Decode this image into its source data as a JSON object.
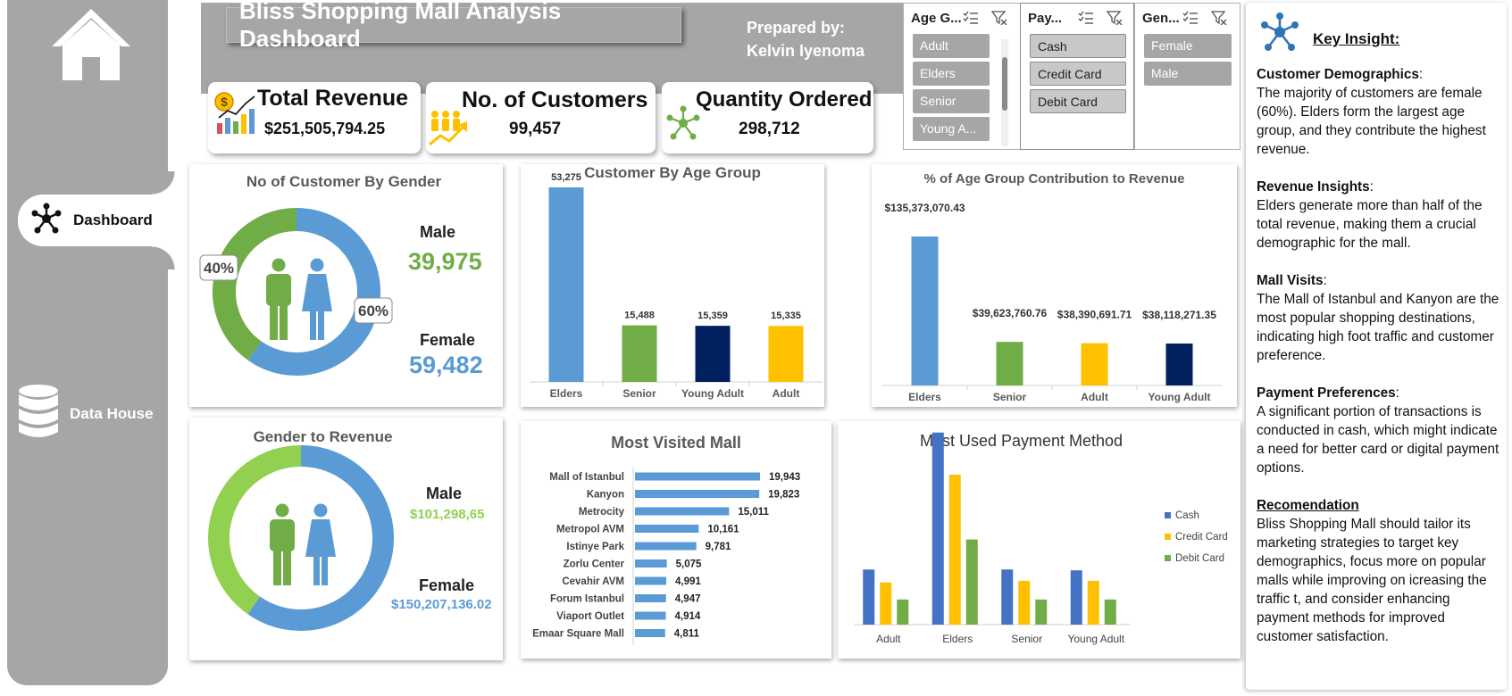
{
  "header": {
    "title": "Bliss Shopping Mall Analysis Dashboard",
    "prepared_label": "Prepared by:",
    "prepared_name": "Kelvin Iyenoma"
  },
  "sidebar": {
    "dashboard_label": "Dashboard",
    "datahouse_label": "Data House"
  },
  "kpis": {
    "revenue": {
      "title": "Total Revenue",
      "value": "$251,505,794.25"
    },
    "customers": {
      "title": "No. of Customers",
      "value": "99,457"
    },
    "quantity": {
      "title": "Quantity Ordered",
      "value": "298,712"
    }
  },
  "slicers": {
    "age": {
      "header": "Age G...",
      "items": [
        "Adult",
        "Elders",
        "Senior",
        "Young A..."
      ]
    },
    "payment": {
      "header": "Pay...",
      "items": [
        "Cash",
        "Credit Card",
        "Debit Card"
      ]
    },
    "gender": {
      "header": "Gen...",
      "items": [
        "Female",
        "Male"
      ]
    }
  },
  "colors": {
    "blue": "#5b9bd5",
    "green": "#70ad47",
    "light_green": "#92d050",
    "navy": "#002060",
    "gold": "#ffc000",
    "royal": "#4472c4"
  },
  "icons": [
    "home-icon",
    "network-icon",
    "database-icon",
    "revenue-chart-icon",
    "customers-growth-icon",
    "molecule-icon",
    "checklist-icon",
    "clear-filter-icon",
    "male-icon",
    "female-icon"
  ],
  "gender_customers": {
    "title": "No of Customer By Gender",
    "male_label": "Male",
    "male_value": "39,975",
    "female_label": "Female",
    "female_value": "59,482",
    "male_pct_label": "40%",
    "female_pct_label": "60%"
  },
  "gender_revenue": {
    "title": "Gender to Revenue",
    "male_label": "Male",
    "male_value": "$101,298,65",
    "female_label": "Female",
    "female_value": "$150,207,136.02"
  },
  "insights": {
    "title": "Key Insight:",
    "sections": [
      {
        "heading": "Customer Demographics",
        "text": "The majority of customers are female (60%). Elders form the largest age group, and they contribute the highest revenue."
      },
      {
        "heading": "Revenue Insights",
        "text": "Elders generate more than half of the total revenue, making them a crucial demographic for the mall."
      },
      {
        "heading": "Mall Visits",
        "text": "The Mall of Istanbul and Kanyon are the most popular shopping destinations, indicating high foot traffic and customer preference."
      },
      {
        "heading": "Payment Preferences",
        "text": "A significant portion of transactions is conducted in cash, which might indicate a need for better card or digital payment options."
      },
      {
        "heading": "Recomendation",
        "text": "Bliss Shopping Mall should tailor its marketing strategies to target key demographics, focus more on popular malls while improving on icreasing the traffic t, and consider enhancing payment methods for improved customer satisfaction."
      }
    ]
  },
  "chart_data": [
    {
      "type": "pie",
      "title": "No of Customer By Gender",
      "categories": [
        "Male",
        "Female"
      ],
      "values": [
        39975,
        59482
      ],
      "data_labels": [
        "40%",
        "60%"
      ]
    },
    {
      "type": "bar",
      "title": "Customer By Age Group",
      "categories": [
        "Elders",
        "Senior",
        "Young Adult",
        "Adult"
      ],
      "values": [
        53275,
        15488,
        15359,
        15335
      ],
      "data_labels": [
        "53,275",
        "15,488",
        "15,359",
        "15,335"
      ],
      "bar_colors": [
        "#5b9bd5",
        "#70ad47",
        "#002060",
        "#ffc000"
      ],
      "ylim": [
        0,
        53275
      ]
    },
    {
      "type": "bar",
      "title": "% of Age Group Contribution  to Revenue",
      "categories": [
        "Elders",
        "Senior",
        "Adult",
        "Young Adult"
      ],
      "values": [
        135373070.43,
        39623760.76,
        38390691.71,
        38118271.35
      ],
      "data_labels": [
        "$135,373,070.43",
        "$39,623,760.76",
        "$38,390,691.71",
        "$38,118,271.35"
      ],
      "bar_colors": [
        "#5b9bd5",
        "#70ad47",
        "#ffc000",
        "#002060"
      ],
      "ylim": [
        0,
        135373070.43
      ]
    },
    {
      "type": "pie",
      "title": "Gender to Revenue",
      "categories": [
        "Male",
        "Female"
      ],
      "values": [
        101298658.23,
        150207136.02
      ]
    },
    {
      "type": "bar",
      "orientation": "horizontal",
      "title": "Most Visited Mall",
      "categories": [
        "Mall of Istanbul",
        "Kanyon",
        "Metrocity",
        "Metropol AVM",
        "Istinye Park",
        "Zorlu Center",
        "Cevahir AVM",
        "Forum Istanbul",
        "Viaport Outlet",
        "Emaar Square Mall"
      ],
      "values": [
        19943,
        19823,
        15011,
        10161,
        9781,
        5075,
        4991,
        4947,
        4914,
        4811
      ],
      "data_labels": [
        "19,943",
        "19,823",
        "15,011",
        "10,161",
        "9,781",
        "5,075",
        "4,991",
        "4,947",
        "4,914",
        "4,811"
      ],
      "xlim": [
        0,
        19943
      ]
    },
    {
      "type": "bar",
      "title": "Most Used Payment Method",
      "categories": [
        "Adult",
        "Elders",
        "Senior",
        "Young Adult"
      ],
      "series": [
        {
          "name": "Cash",
          "color": "#4472c4",
          "values": [
            6800,
            23700,
            6800,
            6700
          ]
        },
        {
          "name": "Credit Card",
          "color": "#ffc000",
          "values": [
            5200,
            18500,
            5400,
            5400
          ]
        },
        {
          "name": "Debit Card",
          "color": "#70ad47",
          "values": [
            3100,
            10500,
            3100,
            3100
          ]
        }
      ],
      "legend": "right",
      "ylim": [
        0,
        24000
      ]
    }
  ]
}
